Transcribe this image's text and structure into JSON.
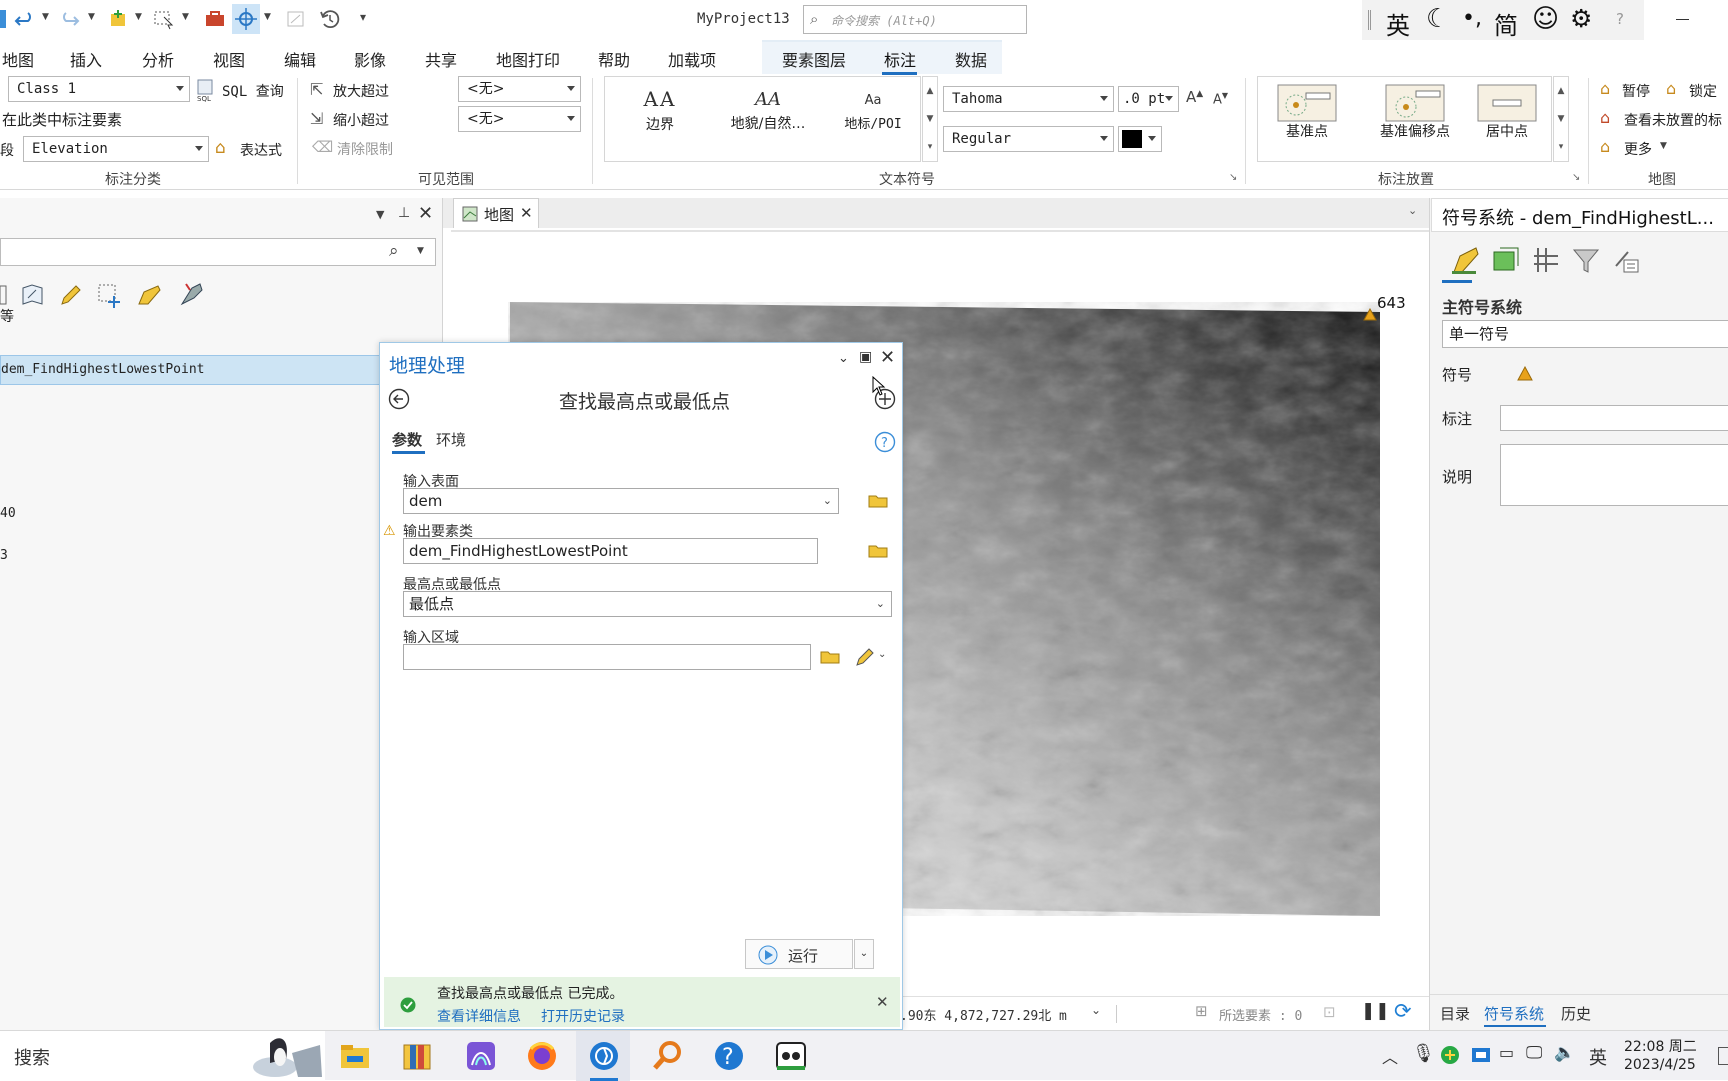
{
  "project_name": "MyProject13",
  "command_search": {
    "placeholder": "命令搜索 (Alt+Q)"
  },
  "ime": {
    "lang": "英",
    "simplified": "简"
  },
  "menu": [
    "地图",
    "插入",
    "分析",
    "视图",
    "编辑",
    "影像",
    "共享",
    "地图打印",
    "帮助",
    "加载项"
  ],
  "context_tabs": [
    "要素图层",
    "标注",
    "数据"
  ],
  "ribbon": {
    "class_select": "Class 1",
    "sql_query": "SQL 查询",
    "label_in_class": "在此类中标注要素",
    "field_prefix": "段",
    "field_select": "Elevation",
    "expression": "表达式",
    "group_classification": "标注分类",
    "zoom_in_beyond": "放大超过",
    "zoom_out_beyond": "缩小超过",
    "clear_limits": "清除限制",
    "scale_min": "<无>",
    "scale_max": "<无>",
    "group_visible_range": "可见范围",
    "text_styles": [
      {
        "glyph": "AA",
        "label": "边界"
      },
      {
        "glyph": "AA",
        "label": "地貌/自然…"
      },
      {
        "glyph": "Aa",
        "label": "地标/POI"
      }
    ],
    "font_name": "Tahoma",
    "font_size": ".0 pt",
    "font_style": "Regular",
    "text_color": "#000000",
    "group_text_symbol": "文本符号",
    "placements": [
      "基准点",
      "基准偏移点",
      "居中点"
    ],
    "group_placement": "标注放置",
    "pause": "暂停",
    "lock": "锁定",
    "view_unplaced": "查看未放置的标",
    "more": "更多",
    "group_map": "地图"
  },
  "contents": {
    "layer_name": "dem_FindHighestLowestPoint",
    "frag_top": "等",
    "frag_1": "40",
    "frag_2": "3"
  },
  "map": {
    "tab_label": "地图",
    "point_label": "643",
    "coordinates": ".90东  4,872,727.29北 m",
    "selected_features": "所选要素 : 0",
    "marker_color": "#e8a21b"
  },
  "geoprocessing": {
    "title": "地理处理",
    "tool_name": "查找最高点或最低点",
    "tabs": [
      "参数",
      "环境"
    ],
    "input_surface_label": "输入表面",
    "input_surface": "dem",
    "output_label": "输出要素类",
    "output_value": "dem_FindHighestLowestPoint",
    "mode_label": "最高点或最低点",
    "mode_value": "最低点",
    "zone_label": "输入区域",
    "zone_value": "",
    "run": "运行",
    "status_msg": "查找最高点或最低点 已完成。",
    "view_details": "查看详细信息",
    "open_history": "打开历史记录"
  },
  "symbology": {
    "title": "符号系统 - dem_FindHighestL...",
    "primary": "主符号系统",
    "method": "单一符号",
    "symbol_label": "符号",
    "label_label": "标注",
    "label_value": "",
    "desc_label": "说明",
    "desc_value": "",
    "bottom_tabs": [
      "目录",
      "符号系统",
      "历史"
    ]
  },
  "taskbar": {
    "search": "搜索",
    "time": "22:08 周二",
    "date": "2023/4/25",
    "lang": "英"
  }
}
